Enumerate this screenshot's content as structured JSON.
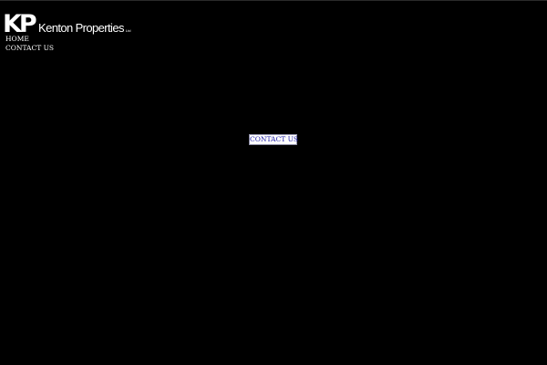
{
  "logo": {
    "mark": "KP",
    "name": "Kenton Properties",
    "suffix": "Ltd"
  },
  "nav": {
    "items": [
      {
        "label": "HOME"
      },
      {
        "label": "CONTACT US"
      }
    ]
  },
  "main": {
    "contact_button_label": "CONTACT US"
  },
  "colors": {
    "background": "#000000",
    "text": "#ffffff",
    "button_text": "#1a1aa6"
  }
}
